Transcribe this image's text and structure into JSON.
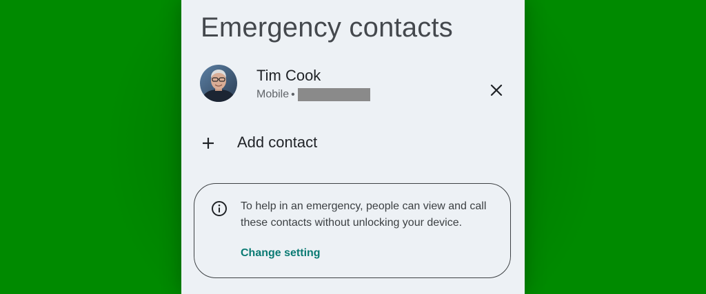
{
  "page": {
    "background_color": "#008a00",
    "panel_color": "#edf1f5",
    "title": "Emergency contacts"
  },
  "contacts": [
    {
      "name": "Tim Cook",
      "phone_type": "Mobile",
      "separator": "•",
      "phone_number_redacted": true,
      "avatar_icon": "contact-photo",
      "remove_icon": "close-icon"
    }
  ],
  "add_contact": {
    "icon": "plus-icon",
    "label": "Add contact"
  },
  "info_card": {
    "icon": "info-icon",
    "text": "To help in an emergency, people can view and call these contacts without unlocking your device.",
    "link_label": "Change setting",
    "link_color": "#0a7a73"
  }
}
